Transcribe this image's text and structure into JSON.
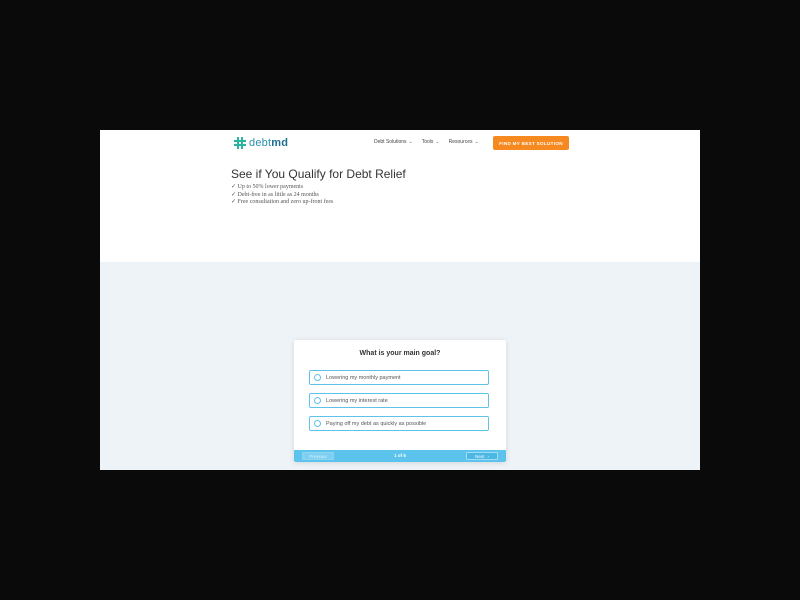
{
  "brand": {
    "name_light": "debt",
    "name_bold": "md",
    "accent_color": "#2bb4a0"
  },
  "nav": {
    "items": [
      {
        "label": "Debt Solutions",
        "icon": "chevron-down-icon"
      },
      {
        "label": "Tools",
        "icon": "chevron-down-icon"
      },
      {
        "label": "Resources",
        "icon": "chevron-down-icon"
      }
    ],
    "cta_label": "FIND MY BEST SOLUTION",
    "cta_color": "#f6891f"
  },
  "hero": {
    "title": "See if You Qualify for Debt Relief",
    "benefits": [
      "✓ Up to 50% lower payments",
      "✓ Debt-free in as little as 24 months",
      "✓ Free consultation and zero up-front fees"
    ]
  },
  "quiz": {
    "question": "What is your main goal?",
    "options": [
      "Lowering my monthly payment",
      "Lowering my interest rate",
      "Paying off my debt as quickly as possible"
    ],
    "prev_label": "Previous",
    "step": "1 of 6",
    "next_label": "Next",
    "next_icon": "chevron-right-icon",
    "bar_color": "#5bc3ec"
  }
}
